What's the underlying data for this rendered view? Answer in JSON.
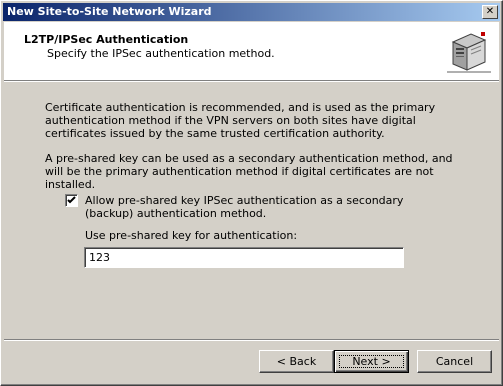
{
  "window": {
    "title": "New Site-to-Site Network Wizard",
    "close_glyph": "✕"
  },
  "header": {
    "title": "L2TP/IPSec Authentication",
    "subtitle": "Specify the IPSec authentication method.",
    "icon": "network-server-icon"
  },
  "body": {
    "paragraph1": "Certificate authentication is recommended, and is used as the primary authentication method if the VPN servers on both sites have digital certificates issued by the same trusted certification authority.",
    "paragraph2": "A pre-shared key can be used as a secondary authentication method, and will be the primary authentication method if digital certificates are not installed.",
    "checkbox": {
      "checked": true,
      "label": "Allow pre-shared key IPSec authentication as a secondary (backup) authentication method."
    },
    "key_field": {
      "label": "Use pre-shared key for authentication:",
      "value": "123"
    }
  },
  "buttons": {
    "back": "< Back",
    "next": "Next >",
    "cancel": "Cancel"
  },
  "colors": {
    "titlebar_start": "#0a246a",
    "titlebar_end": "#a6caf0",
    "dialog_bg": "#d4d0c8"
  }
}
